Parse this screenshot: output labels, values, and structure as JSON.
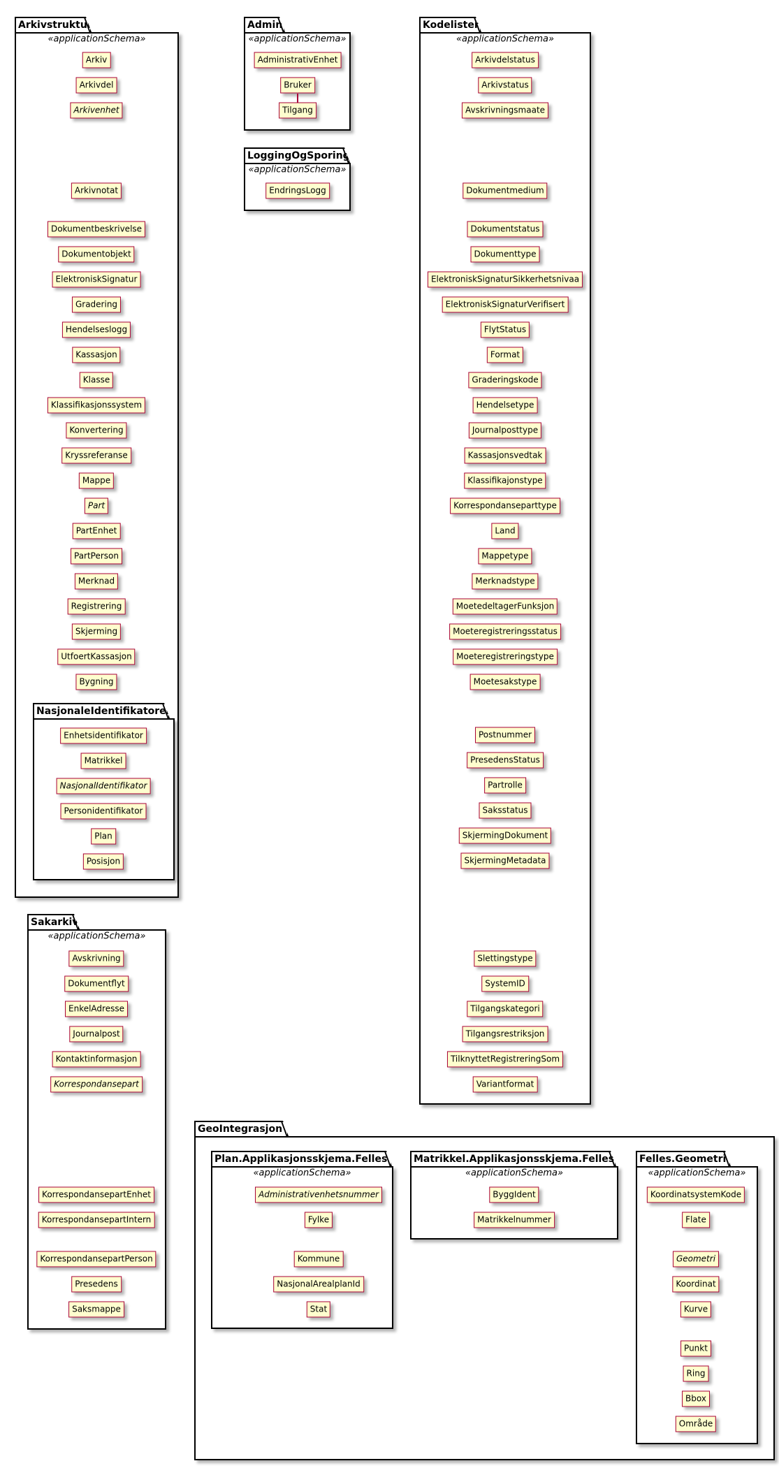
{
  "packages": {
    "arkivstruktur": {
      "name": "Arkivstruktur",
      "stereotype": "«applicationSchema»",
      "classes": [
        {
          "name": "Arkiv"
        },
        {
          "name": "Arkivdel"
        },
        {
          "name": "Arkivenhet",
          "abstract": true
        },
        {
          "name": "Arkivnotat"
        },
        {
          "name": "Dokumentbeskrivelse"
        },
        {
          "name": "Dokumentobjekt"
        },
        {
          "name": "ElektroniskSignatur"
        },
        {
          "name": "Gradering"
        },
        {
          "name": "Hendelseslogg"
        },
        {
          "name": "Kassasjon"
        },
        {
          "name": "Klasse"
        },
        {
          "name": "Klassifikasjonssystem"
        },
        {
          "name": "Konvertering"
        },
        {
          "name": "Kryssreferanse"
        },
        {
          "name": "Mappe"
        },
        {
          "name": "Part",
          "abstract": true
        },
        {
          "name": "PartEnhet"
        },
        {
          "name": "PartPerson"
        },
        {
          "name": "Merknad"
        },
        {
          "name": "Registrering"
        },
        {
          "name": "Skjerming"
        },
        {
          "name": "UtfoertKassasjon"
        },
        {
          "name": "Bygning"
        }
      ]
    },
    "nasjonale": {
      "name": "NasjonaleIdentifikatorer",
      "classes": [
        {
          "name": "Enhetsidentifikator"
        },
        {
          "name": "Matrikkel"
        },
        {
          "name": "NasjonalIdentifikator",
          "abstract": true
        },
        {
          "name": "Personidentifikator"
        },
        {
          "name": "Plan"
        },
        {
          "name": "Posisjon"
        }
      ]
    },
    "admin": {
      "name": "Admin",
      "stereotype": "«applicationSchema»",
      "classes": [
        {
          "name": "AdministrativEnhet"
        },
        {
          "name": "Bruker"
        },
        {
          "name": "Tilgang"
        }
      ]
    },
    "logging": {
      "name": "LoggingOgSporing",
      "stereotype": "«applicationSchema»",
      "classes": [
        {
          "name": "EndringsLogg"
        }
      ]
    },
    "kodelister": {
      "name": "Kodelister",
      "stereotype": "«applicationSchema»",
      "classes": [
        {
          "name": "Arkivdelstatus"
        },
        {
          "name": "Arkivstatus"
        },
        {
          "name": "Avskrivningsmaate"
        },
        {
          "name": "Dokumentmedium"
        },
        {
          "name": "Dokumentstatus"
        },
        {
          "name": "Dokumenttype"
        },
        {
          "name": "ElektroniskSignaturSikkerhetsnivaa"
        },
        {
          "name": "ElektroniskSignaturVerifisert"
        },
        {
          "name": "FlytStatus"
        },
        {
          "name": "Format"
        },
        {
          "name": "Graderingskode"
        },
        {
          "name": "Hendelsetype"
        },
        {
          "name": "Journalposttype"
        },
        {
          "name": "Kassasjonsvedtak"
        },
        {
          "name": "Klassifikajonstype"
        },
        {
          "name": "Korrespondanseparttype"
        },
        {
          "name": "Land"
        },
        {
          "name": "Mappetype"
        },
        {
          "name": "Merknadstype"
        },
        {
          "name": "MoetedeltagerFunksjon"
        },
        {
          "name": "Moeteregistreringsstatus"
        },
        {
          "name": "Moeteregistreringstype"
        },
        {
          "name": "Moetesakstype"
        },
        {
          "name": "Postnummer"
        },
        {
          "name": "PresedensStatus"
        },
        {
          "name": "Partrolle"
        },
        {
          "name": "Saksstatus"
        },
        {
          "name": "SkjermingDokument"
        },
        {
          "name": "SkjermingMetadata"
        },
        {
          "name": "Slettingstype"
        },
        {
          "name": "SystemID"
        },
        {
          "name": "Tilgangskategori"
        },
        {
          "name": "Tilgangsrestriksjon"
        },
        {
          "name": "TilknyttetRegistreringSom"
        },
        {
          "name": "Variantformat"
        }
      ]
    },
    "sakarkiv": {
      "name": "Sakarkiv",
      "stereotype": "«applicationSchema»",
      "classes": [
        {
          "name": "Avskrivning"
        },
        {
          "name": "Dokumentflyt"
        },
        {
          "name": "EnkelAdresse"
        },
        {
          "name": "Journalpost"
        },
        {
          "name": "Kontaktinformasjon"
        },
        {
          "name": "Korrespondansepart",
          "abstract": true
        },
        {
          "name": "KorrespondansepartEnhet"
        },
        {
          "name": "KorrespondansepartIntern"
        },
        {
          "name": "KorrespondansepartPerson"
        },
        {
          "name": "Presedens"
        },
        {
          "name": "Saksmappe"
        }
      ]
    },
    "geo": {
      "name": "GeoIntegrasjon",
      "classes": []
    },
    "plan": {
      "name": "Plan.Applikasjonsskjema.Felles",
      "stereotype": "«applicationSchema»",
      "classes": [
        {
          "name": "Administrativenhetsnummer",
          "abstract": true
        },
        {
          "name": "Fylke"
        },
        {
          "name": "Kommune"
        },
        {
          "name": "NasjonalArealplanId"
        },
        {
          "name": "Stat"
        }
      ]
    },
    "matrikkel": {
      "name": "Matrikkel.Applikasjonsskjema.Felles",
      "stereotype": "«applicationSchema»",
      "classes": [
        {
          "name": "ByggIdent"
        },
        {
          "name": "Matrikkelnummer"
        }
      ]
    },
    "felles": {
      "name": "Felles.Geometri",
      "stereotype": "«applicationSchema»",
      "classes": [
        {
          "name": "KoordinatsystemKode"
        },
        {
          "name": "Flate"
        },
        {
          "name": "Geometri",
          "abstract": true
        },
        {
          "name": "Koordinat"
        },
        {
          "name": "Kurve"
        },
        {
          "name": "Punkt"
        },
        {
          "name": "Ring"
        },
        {
          "name": "Bbox"
        },
        {
          "name": "Område"
        }
      ]
    }
  },
  "links": [
    {
      "from": "Bruker",
      "to": "Tilgang"
    }
  ],
  "colors": {
    "class_fill": "#FEFECE",
    "class_border": "#A80036",
    "package_border": "#000000"
  }
}
